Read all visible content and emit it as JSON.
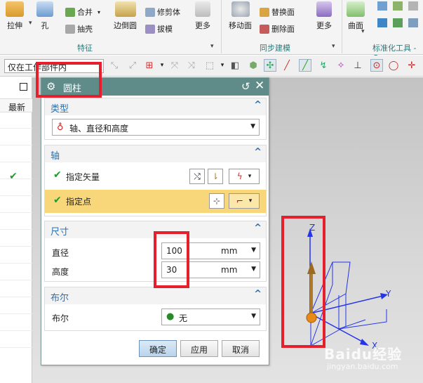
{
  "ribbon": {
    "big_buttons": [
      {
        "label": "拉伸",
        "icon": "extrude-icon"
      },
      {
        "label": "孔",
        "icon": "hole-icon"
      },
      {
        "label": "边倒圆",
        "icon": "edge-blend-icon"
      },
      {
        "label": "更多",
        "icon": "more-icon"
      },
      {
        "label": "移动面",
        "icon": "move-face-icon"
      },
      {
        "label": "更多",
        "icon": "more-icon"
      },
      {
        "label": "曲面",
        "icon": "surface-icon"
      }
    ],
    "small_buttons": [
      {
        "label": "合并",
        "icon": "unite-icon"
      },
      {
        "label": "抽壳",
        "icon": "shell-icon"
      },
      {
        "label": "修剪体",
        "icon": "trim-body-icon"
      },
      {
        "label": "拔模",
        "icon": "draft-icon"
      },
      {
        "label": "替换面",
        "icon": "replace-face-icon"
      },
      {
        "label": "删除面",
        "icon": "delete-face-icon"
      }
    ],
    "groups": {
      "feature": "特征",
      "sync_modeling": "同步建模",
      "standard_tools": "标准化工具 - G"
    }
  },
  "toolbar2": {
    "filter_value": "仅在工作部件内"
  },
  "tree": {
    "column_header": "最新"
  },
  "dialog": {
    "title": "圆柱",
    "sections": {
      "type": {
        "title": "类型",
        "selected": "轴、直径和高度"
      },
      "axis": {
        "title": "轴",
        "specify_vector": "指定矢量",
        "specify_point": "指定点"
      },
      "dimensions": {
        "title": "尺寸",
        "diameter_label": "直径",
        "diameter_value": "100",
        "diameter_unit": "mm",
        "height_label": "高度",
        "height_value": "30",
        "height_unit": "mm"
      },
      "boolean": {
        "title": "布尔",
        "label": "布尔",
        "value": "无"
      }
    },
    "buttons": {
      "ok": "确定",
      "apply": "应用",
      "cancel": "取消"
    }
  },
  "axes": {
    "z": "Z",
    "y": "Y",
    "x": "X"
  },
  "watermark": {
    "brand": "Baidu经验",
    "url": "jingyan.baidu.com"
  },
  "colors": {
    "dialog_title_bg": "#5f8b88",
    "section_title": "#2b6fb0",
    "highlight_row": "#f8d77b",
    "check": "#1e9a2e",
    "annotation_red": "#e5202c"
  }
}
